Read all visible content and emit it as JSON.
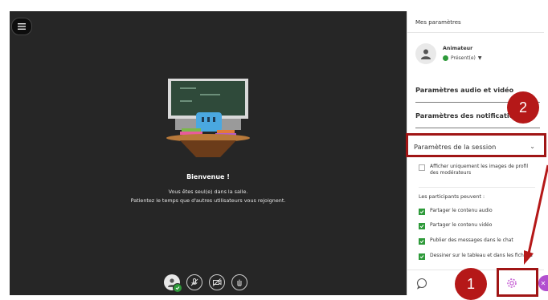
{
  "stage": {
    "welcome_title": "Bienvenue !",
    "welcome_line1": "Vous êtes seul(e) dans la salle.",
    "welcome_line2": "Patientez le temps que d'autres utilisateurs vous rejoignent."
  },
  "panel": {
    "title": "Mes paramètres",
    "user_role": "Animateur",
    "user_status": "Présent(e)",
    "section_audio": "Paramètres audio et vidéo",
    "section_notifications": "Paramètres des notifications",
    "section_session": "Paramètres de la session",
    "moderators_only_images": "Afficher uniquement les images de profil des modérateurs",
    "participants_can": "Les participants peuvent :",
    "perm_audio": "Partager le contenu audio",
    "perm_video": "Partager le contenu vidéo",
    "perm_chat": "Publier des messages dans le chat",
    "perm_draw": "Dessiner sur le tableau et dans les fichiers"
  },
  "annotations": {
    "step1": "1",
    "step2": "2"
  },
  "colors": {
    "stage_bg": "#262626",
    "accent_green": "#2e9a3a",
    "annotation_red": "#b51818",
    "collab_purple": "#b24fcf"
  }
}
